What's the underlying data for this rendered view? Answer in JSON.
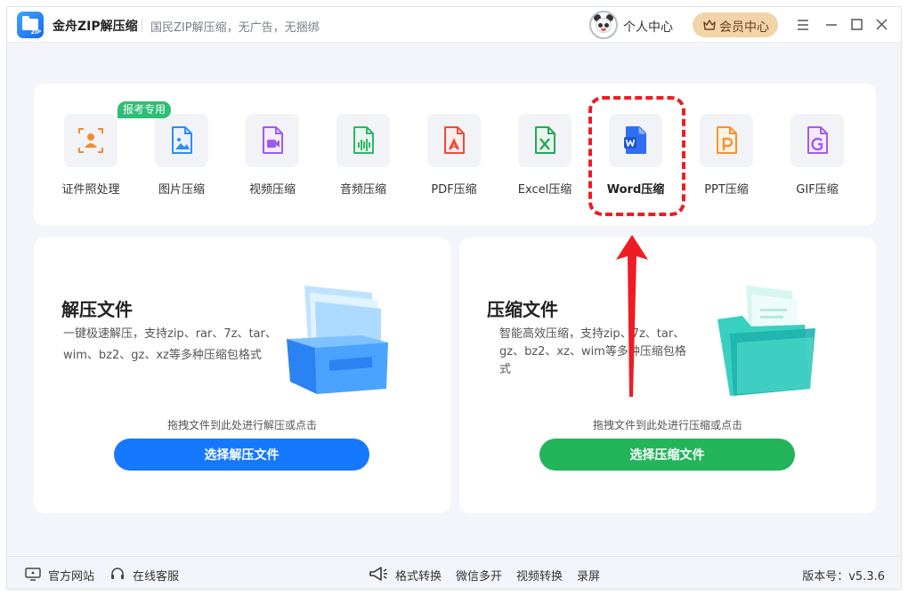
{
  "titlebar": {
    "app_name": "金舟ZIP解压缩",
    "slogan": "国民ZIP解压缩，无广告，无捆绑",
    "logo_text": "ZIP",
    "personal_center": "个人中心",
    "vip_center": "会员中心"
  },
  "tools": {
    "badge": "报考专用",
    "items": [
      {
        "label": "证件照处理",
        "icon": "id-photo-icon",
        "color": "#f08c2e"
      },
      {
        "label": "图片压缩",
        "icon": "image-icon",
        "color": "#2f8cf5"
      },
      {
        "label": "视频压缩",
        "icon": "video-icon",
        "color": "#9b5cf0"
      },
      {
        "label": "音频压缩",
        "icon": "audio-icon",
        "color": "#2fb56b"
      },
      {
        "label": "PDF压缩",
        "icon": "pdf-icon",
        "color": "#ee4a3a"
      },
      {
        "label": "Excel压缩",
        "icon": "excel-icon",
        "color": "#2aa55a"
      },
      {
        "label": "Word压缩",
        "icon": "word-icon",
        "color": "#2f6ff0"
      },
      {
        "label": "PPT压缩",
        "icon": "ppt-icon",
        "color": "#f5922f"
      },
      {
        "label": "GIF压缩",
        "icon": "gif-icon",
        "color": "#a45ce8"
      }
    ]
  },
  "cards": {
    "extract": {
      "title": "解压文件",
      "desc": "一键极速解压，支持zip、rar、7z、tar、wim、bz2、gz、xz等多种压缩包格式",
      "hint": "拖拽文件到此处进行解压或点击",
      "button": "选择解压文件"
    },
    "compress": {
      "title": "压缩文件",
      "desc": "智能高效压缩，支持zip、7z、tar、gz、bz2、xz、wim等多种压缩包格式",
      "hint": "拖拽文件到此处进行压缩或点击",
      "button": "选择压缩文件"
    }
  },
  "statusbar": {
    "website": "官方网站",
    "support": "在线客服",
    "format_convert": "格式转换",
    "wechat_multi": "微信多开",
    "video_convert": "视频转换",
    "record": "录屏",
    "version": "版本号：v5.3.6"
  },
  "colors": {
    "primary_blue": "#1677ff",
    "primary_green": "#23b45c",
    "vip_gold": "#f3d4a8",
    "badge_green": "#2dbe74",
    "annotation_red": "#ee1c24"
  }
}
